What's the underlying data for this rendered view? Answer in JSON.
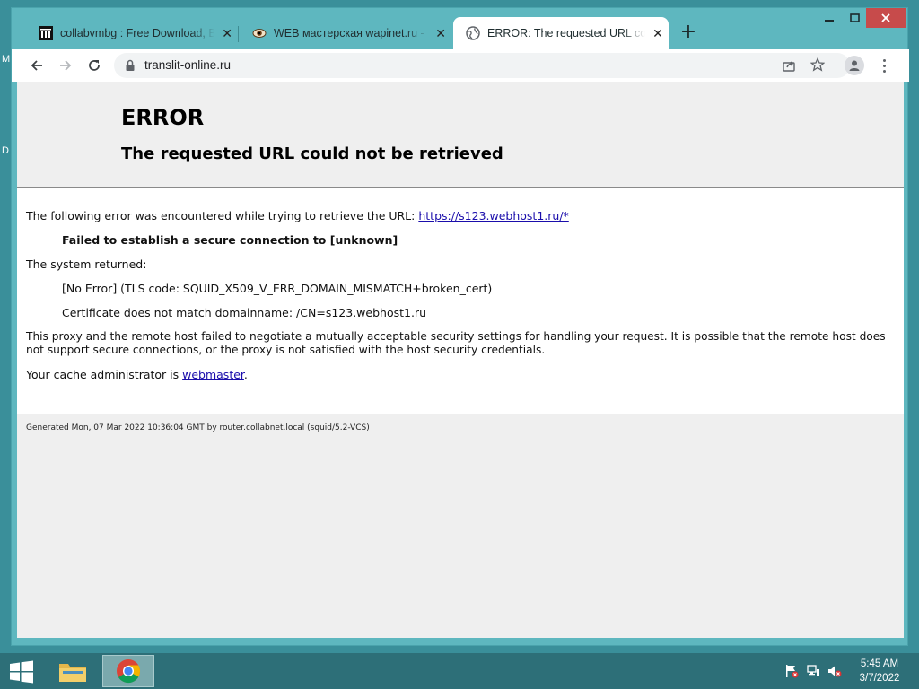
{
  "desktop": {
    "letters": [
      "M",
      "D"
    ]
  },
  "tabs": [
    {
      "title": "collabvmbg : Free Download, Bo",
      "active": false
    },
    {
      "title": "WEB мастерская wapinet.ru - Sc",
      "active": false
    },
    {
      "title": "ERROR: The requested URL could",
      "active": true
    }
  ],
  "toolbar": {
    "url": "translit-online.ru"
  },
  "page": {
    "h1": "ERROR",
    "h2": "The requested URL could not be retrieved",
    "intro": "The following error was encountered while trying to retrieve the URL: ",
    "intro_link": "https://s123.webhost1.ru/*",
    "failure": "Failed to establish a secure connection to [unknown]",
    "system_returned": "The system returned:",
    "sys_error": "[No Error] (TLS code: SQUID_X509_V_ERR_DOMAIN_MISMATCH+broken_cert)",
    "cert_msg": "Certificate does not match domainname: /CN=s123.webhost1.ru",
    "explanation_1": "This proxy and the remote host failed to negotiate a mutually acceptable security settings for handling your request. It is possible that the remote host does",
    "explanation_2": "not support secure connections, or the proxy is not satisfied with the host security credentials.",
    "admin_prefix": "Your cache administrator is ",
    "admin_link": "webmaster",
    "admin_suffix": ".",
    "generated": "Generated Mon, 07 Mar 2022 10:36:04 GMT by router.collabnet.local (squid/5.2-VCS)"
  },
  "taskbar": {
    "time": "5:45 AM",
    "date": "3/7/2022"
  },
  "colors": {
    "accent": "#5eb7bf",
    "link": "#1a0dab",
    "close": "#c74b4b"
  }
}
